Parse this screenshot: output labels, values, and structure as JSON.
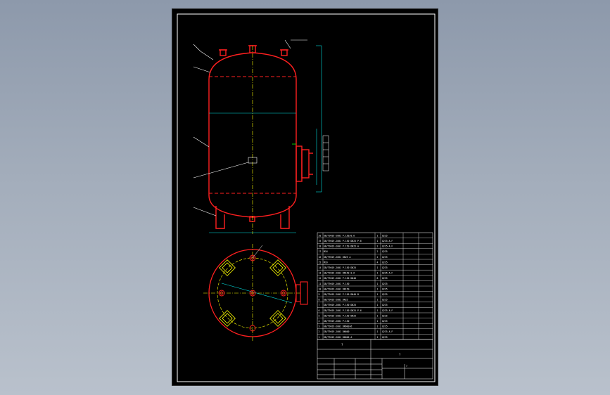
{
  "title_block": {
    "label_main": "?",
    "label_right": "?",
    "label_sub": "?"
  },
  "bom": {
    "rows": [
      {
        "no": "20",
        "spec": "GB/T9019-2001 P.150/0.6",
        "qty": "1",
        "mat": "Q235",
        "note": ""
      },
      {
        "no": "19",
        "spec": "GB/T9019-2001 P.150 DN25 P.6",
        "qty": "1",
        "mat": "Q235-A.F",
        "note": ""
      },
      {
        "no": "18",
        "spec": "GB/T9019-2001 P.150 DN25 A",
        "qty": "2",
        "mat": "Q235-A.F",
        "note": ""
      },
      {
        "no": "17",
        "spec": "M16",
        "qty": "2",
        "mat": "Q235",
        "note": ""
      },
      {
        "no": "16",
        "spec": "GB/T9019-2001 DN25 A",
        "qty": "2",
        "mat": "Q235",
        "note": ""
      },
      {
        "no": "15",
        "spec": "M16",
        "qty": "4",
        "mat": "Q235",
        "note": ""
      },
      {
        "no": "14",
        "spec": "GB/T9019-2001 P.150 DN25",
        "qty": "1",
        "mat": "Q235",
        "note": ""
      },
      {
        "no": "13",
        "spec": "GB/T9019-2001 DN150 0.6",
        "qty": "1",
        "mat": "Q235-A.F",
        "note": ""
      },
      {
        "no": "12",
        "spec": "GB/T9019-2001 P.150 DN40",
        "qty": "8",
        "mat": "Q235",
        "note": ""
      },
      {
        "no": "11",
        "spec": "GB/T9019-2001 P.150",
        "qty": "1",
        "mat": "Q235",
        "note": ""
      },
      {
        "no": "10",
        "spec": "GB/T9019-2001 DN150",
        "qty": "1",
        "mat": "Q235",
        "note": ""
      },
      {
        "no": "9",
        "spec": "GB/T9019-2001 P.150 DN40 B",
        "qty": "1",
        "mat": "Q235",
        "note": ""
      },
      {
        "no": "8",
        "spec": "GB/T9019-2001 DN25",
        "qty": "1",
        "mat": "Q235",
        "note": ""
      },
      {
        "no": "7",
        "spec": "GB/T9019-2001 P.150 DN25",
        "qty": "1",
        "mat": "Q235",
        "note": ""
      },
      {
        "no": "6",
        "spec": "GB/T9019-2001 P.150 DN25 P.6",
        "qty": "1",
        "mat": "Q235-A.F",
        "note": ""
      },
      {
        "no": "5",
        "spec": "GB/T9019-2001 P.150 DN25",
        "qty": "1",
        "mat": "Q235",
        "note": ""
      },
      {
        "no": "4",
        "spec": "GB/T9019-2001 P.150",
        "qty": "1",
        "mat": "Q235",
        "note": ""
      },
      {
        "no": "3",
        "spec": "GB/T9019-2001 DN600x6",
        "qty": "1",
        "mat": "Q235",
        "note": ""
      },
      {
        "no": "2",
        "spec": "GB/T9019-2001 DN600",
        "qty": "1",
        "mat": "Q235-A.F",
        "note": ""
      },
      {
        "no": "1",
        "spec": "GB/T9019-2001 DN600 A",
        "qty": "1",
        "mat": "Q235",
        "note": ""
      }
    ]
  },
  "colors": {
    "vessel": "#ff2020",
    "centerline": "#ffff00",
    "dimension": "#00e0e0",
    "table": "#ffffff",
    "sheet": "#000000"
  },
  "icons": {
    "nozzle": "circle-flange",
    "support": "leg"
  }
}
